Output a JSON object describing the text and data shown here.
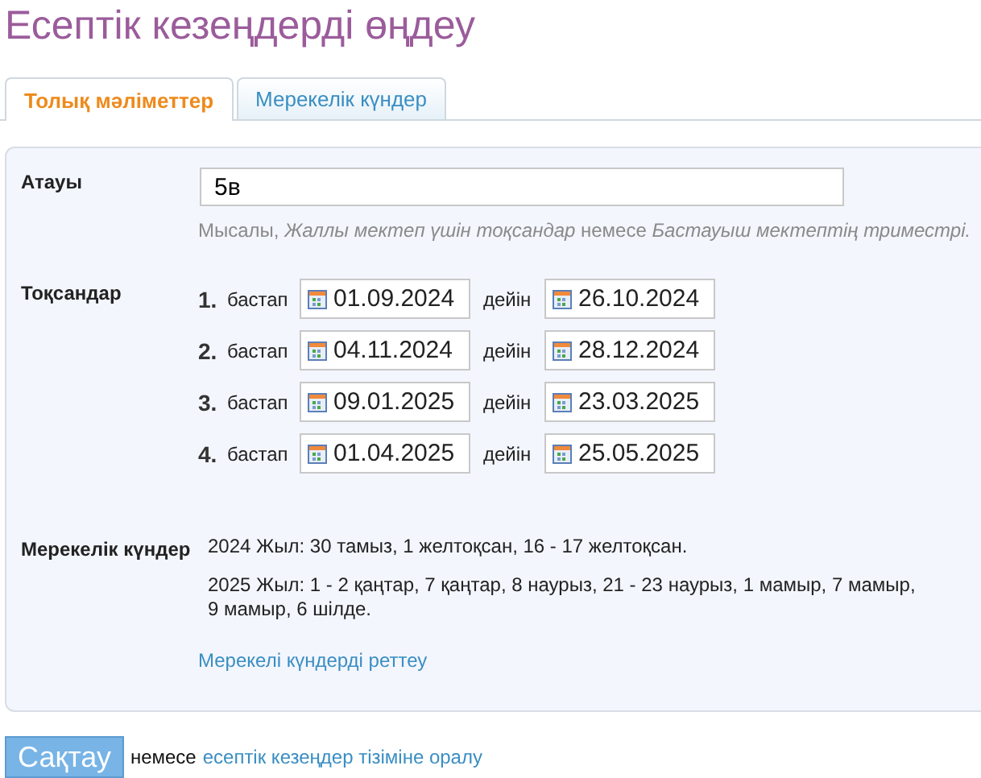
{
  "page_title": "Есептік кезеңдерді өңдеу",
  "tabs": [
    {
      "label": "Толық мәліметтер",
      "selected": true
    },
    {
      "label": "Мерекелік күндер",
      "selected": false
    }
  ],
  "name_field": {
    "label": "Атауы",
    "value": "5в",
    "hint": "Мысалы, *Жаллы мектеп үшін тоқсандар* немесе *Бастауыш мектептің триместрі.*"
  },
  "quarters": {
    "label": "Тоқсандар",
    "rows": [
      {
        "number": "1.",
        "from_label": "бастап",
        "from": "01.09.2024",
        "to_label": "дейін",
        "to": "26.10.2024"
      },
      {
        "number": "2.",
        "from_label": "бастап",
        "from": "04.11.2024",
        "to_label": "дейін",
        "to": "28.12.2024"
      },
      {
        "number": "3.",
        "from_label": "бастап",
        "from": "09.01.2025",
        "to_label": "дейін",
        "to": "23.03.2025"
      },
      {
        "number": "4.",
        "from_label": "бастап",
        "from": "01.04.2025",
        "to_label": "дейін",
        "to": "25.05.2025"
      }
    ]
  },
  "holidays": {
    "label": "Мерекелік күндер",
    "lines": [
      "2024 Жыл: 30 тамыз, 1 желтоқсан, 16 - 17 желтоқсан.",
      "2025 Жыл: 1 - 2 қаңтар, 7 қаңтар, 8 наурыз, 21 - 23 наурыз, 1 мамыр, 7 мамыр, 9 мамыр, 6 шілде."
    ],
    "link": "Мерекелі күндерді реттеу"
  },
  "footer": {
    "save": "Сақтау",
    "or": "немесе",
    "back_link": "есептік кезеңдер тізіміне оралу"
  }
}
